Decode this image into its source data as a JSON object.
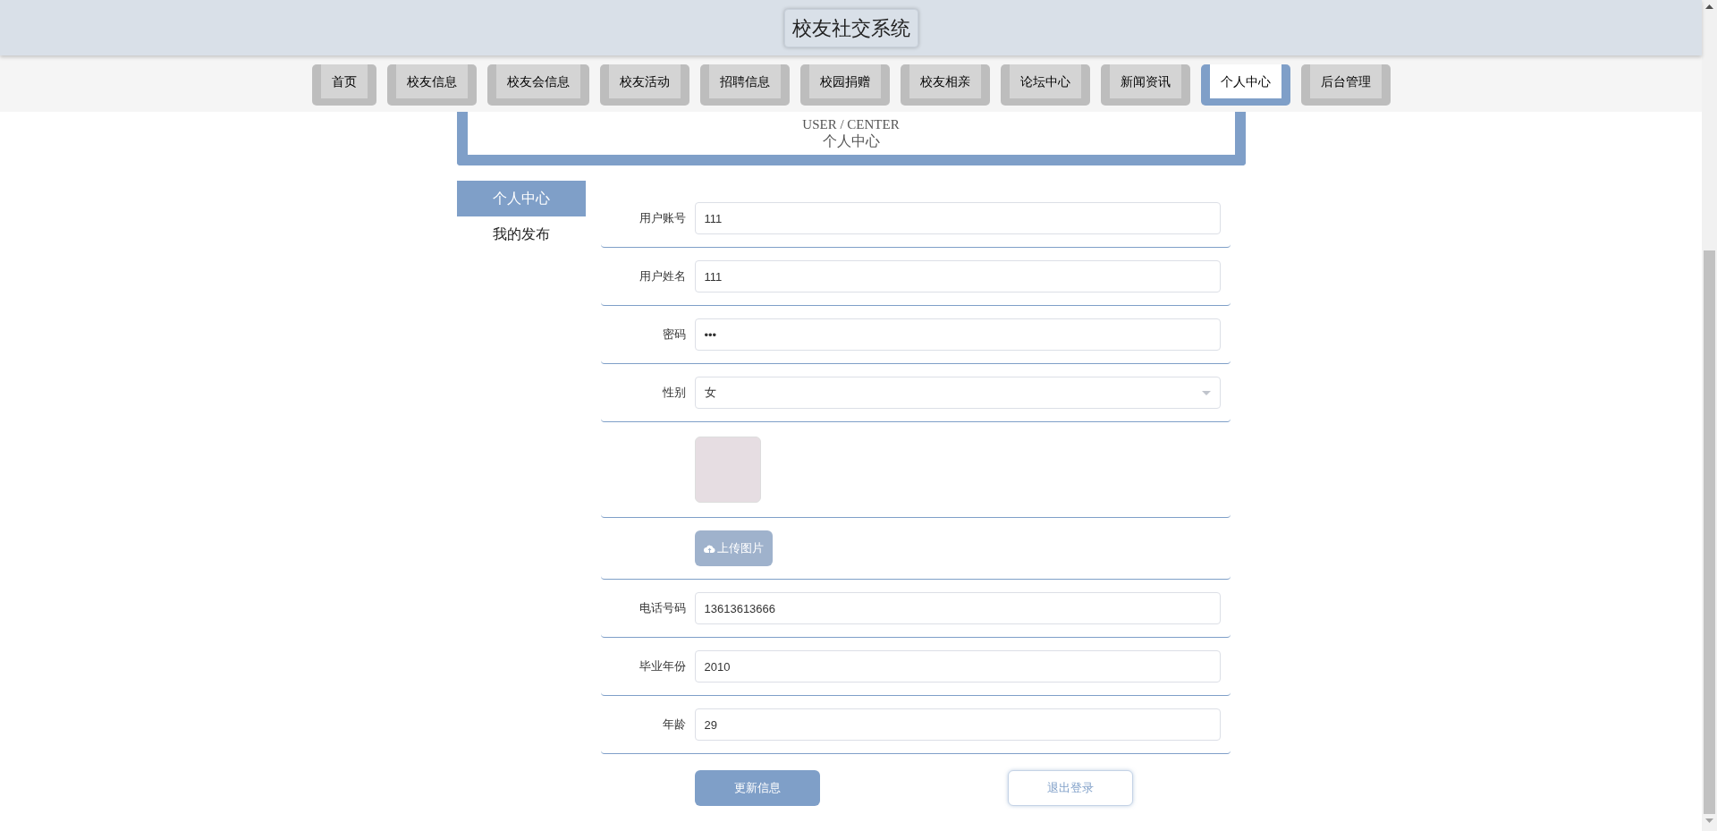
{
  "header": {
    "title": "校友社交系统"
  },
  "nav": [
    {
      "label": "首页",
      "selected": false
    },
    {
      "label": "校友信息",
      "selected": false
    },
    {
      "label": "校友会信息",
      "selected": false
    },
    {
      "label": "校友活动",
      "selected": false
    },
    {
      "label": "招聘信息",
      "selected": false
    },
    {
      "label": "校园捐赠",
      "selected": false
    },
    {
      "label": "校友相亲",
      "selected": false
    },
    {
      "label": "论坛中心",
      "selected": false
    },
    {
      "label": "新闻资讯",
      "selected": false
    },
    {
      "label": "个人中心",
      "selected": true
    },
    {
      "label": "后台管理",
      "selected": false
    }
  ],
  "banner": {
    "subtitle": "USER / CENTER",
    "title": "个人中心"
  },
  "sidebar": {
    "items": [
      {
        "label": "个人中心",
        "selected": true
      },
      {
        "label": "我的发布",
        "selected": false
      }
    ]
  },
  "form": {
    "fields": [
      {
        "kind": "text",
        "label": "用户账号",
        "value": "111"
      },
      {
        "kind": "text",
        "label": "用户姓名",
        "value": "111"
      },
      {
        "kind": "text",
        "label": "密码",
        "value": "•••"
      },
      {
        "kind": "select",
        "label": "性别",
        "value": "女"
      },
      {
        "kind": "image"
      },
      {
        "kind": "upload",
        "button": "上传图片"
      },
      {
        "kind": "text",
        "label": "电话号码",
        "value": "13613613666"
      },
      {
        "kind": "text",
        "label": "毕业年份",
        "value": "2010"
      },
      {
        "kind": "text",
        "label": "年龄",
        "value": "29"
      }
    ],
    "buttons": [
      {
        "kind": "primary",
        "label": "更新信息"
      },
      {
        "kind": "outline",
        "label": "退出登录"
      }
    ]
  }
}
